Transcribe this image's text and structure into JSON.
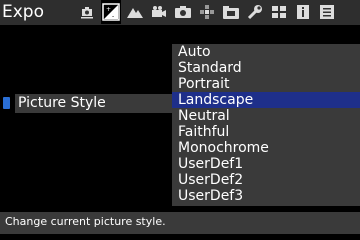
{
  "header": {
    "title": "Expo",
    "tabs": [
      {
        "icon": "camera-shake-icon",
        "active": false
      },
      {
        "icon": "exposure-compensation-icon",
        "active": true
      },
      {
        "icon": "mountain-icon",
        "active": false
      },
      {
        "icon": "movie-camera-icon",
        "active": false
      },
      {
        "icon": "camera-icon",
        "active": false
      },
      {
        "icon": "dpad-icon",
        "active": false
      },
      {
        "icon": "folder-icon",
        "active": false
      },
      {
        "icon": "wrench-icon",
        "active": false
      },
      {
        "icon": "grid-icon",
        "active": false
      },
      {
        "icon": "info-icon",
        "active": false
      },
      {
        "icon": "menu-icon",
        "active": false
      }
    ]
  },
  "setting": {
    "label": "Picture Style"
  },
  "dropdown": {
    "selected": "Landscape",
    "options": [
      "Auto",
      "Standard",
      "Portrait",
      "Landscape",
      "Neutral",
      "Faithful",
      "Monochrome",
      "UserDef1",
      "UserDef2",
      "UserDef3"
    ]
  },
  "status": {
    "help_text": "Change current picture style."
  },
  "colors": {
    "topbar": "#2e2e2e",
    "panel": "#3a3a3a",
    "selection": "#1e2f8a",
    "marker": "#2a6fd6",
    "text": "#ffffff"
  }
}
